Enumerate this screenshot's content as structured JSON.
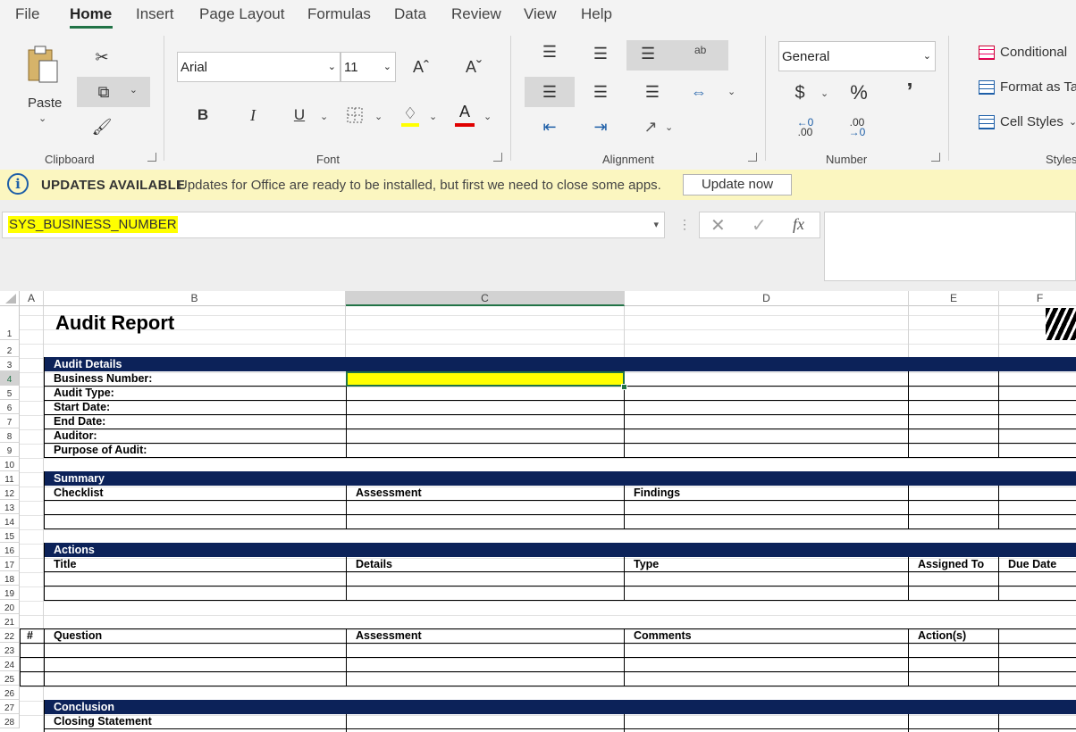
{
  "tabs": [
    "File",
    "Home",
    "Insert",
    "Page Layout",
    "Formulas",
    "Data",
    "Review",
    "View",
    "Help"
  ],
  "active_tab": "Home",
  "ribbon": {
    "clipboard": {
      "label": "Clipboard",
      "paste": "Paste"
    },
    "font": {
      "label": "Font",
      "name": "Arial",
      "size": "11",
      "bold": "B",
      "italic": "I",
      "underline": "U",
      "grow": "Aˆ",
      "shrink": "Aˇ",
      "font_color_glyph": "A",
      "highlight_color": "#ffff00",
      "font_color": "#e00000"
    },
    "alignment": {
      "label": "Alignment",
      "wrap_glyph": "ab"
    },
    "number": {
      "label": "Number",
      "format": "General",
      "currency": "$",
      "percent": "%",
      "comma": "’",
      "inc_decimal": ".00",
      "dec_decimal": ".00"
    },
    "styles": {
      "label": "Styles",
      "conditional": "Conditional",
      "format_as_table": "Format as Ta",
      "cell_styles": "Cell Styles"
    }
  },
  "message_bar": {
    "title": "UPDATES AVAILABLE",
    "text": "Updates for Office are ready to be installed, but first we need to close some apps.",
    "button": "Update now"
  },
  "formula_bar": {
    "name_box": "SYS_BUSINESS_NUMBER",
    "fx": "fx",
    "value": ""
  },
  "columns": [
    "A",
    "B",
    "C",
    "D",
    "E",
    "F"
  ],
  "selected_column": "C",
  "rows": [
    "1",
    "2",
    "3",
    "4",
    "5",
    "6",
    "7",
    "8",
    "9",
    "10",
    "11",
    "12",
    "13",
    "14",
    "15",
    "16",
    "17",
    "18",
    "19",
    "20",
    "21",
    "22",
    "23",
    "24",
    "25",
    "26",
    "27",
    "28"
  ],
  "selected_row": "4",
  "sheet": {
    "title": "Audit Report",
    "audit_details": {
      "header": "Audit Details",
      "labels": [
        "Business Number:",
        "Audit Type:",
        "Start Date:",
        "End Date:",
        "Auditor:",
        "Purpose of Audit:"
      ]
    },
    "summary": {
      "header": "Summary",
      "columns": [
        "Checklist",
        "Assessment",
        "Findings"
      ]
    },
    "actions": {
      "header": "Actions",
      "columns": [
        "Title",
        "Details",
        "Type",
        "Assigned To",
        "Due Date"
      ]
    },
    "questions": {
      "columns": [
        "#",
        "Question",
        "Assessment",
        "Comments",
        "Action(s)"
      ]
    },
    "conclusion": {
      "header": "Conclusion",
      "label": "Closing Statement"
    }
  },
  "colors": {
    "band": "#0c2259",
    "accent": "#217346",
    "highlight": "#ffff00",
    "message_bar": "#fbf6c0"
  }
}
